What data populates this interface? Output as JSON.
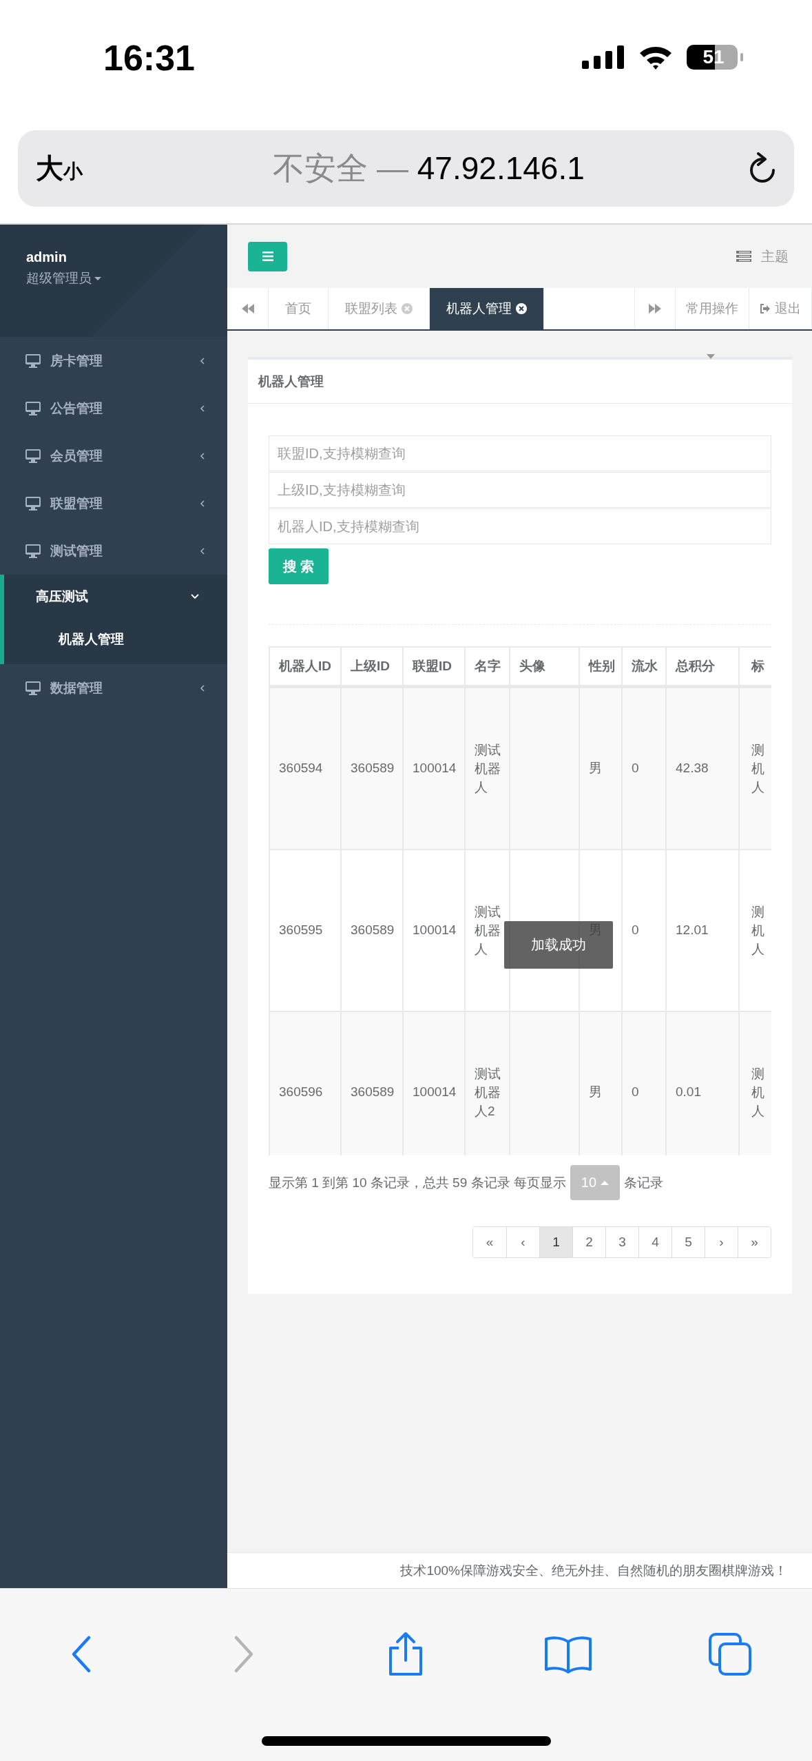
{
  "status_bar": {
    "time": "16:31",
    "battery": "51"
  },
  "browser": {
    "text_size_large": "大",
    "text_size_small": "小",
    "security": "不安全 —",
    "address": "47.92.146.1"
  },
  "sidebar": {
    "user": {
      "name": "admin",
      "role": "超级管理员"
    },
    "items": [
      {
        "label": "房卡管理",
        "expanded": false
      },
      {
        "label": "公告管理",
        "expanded": false
      },
      {
        "label": "会员管理",
        "expanded": false
      },
      {
        "label": "联盟管理",
        "expanded": false
      },
      {
        "label": "测试管理",
        "expanded": false,
        "children": [
          {
            "label": "高压测试",
            "expanded": true,
            "children": [
              {
                "label": "机器人管理",
                "selected": true
              }
            ]
          }
        ]
      },
      {
        "label": "数据管理",
        "expanded": false
      }
    ]
  },
  "header": {
    "theme": "主题"
  },
  "tabs": [
    {
      "label": "首页",
      "closable": false,
      "selected": false
    },
    {
      "label": "联盟列表",
      "closable": true,
      "selected": false
    },
    {
      "label": "机器人管理",
      "closable": true,
      "selected": true
    }
  ],
  "tab_actions": {
    "common": "常用操作",
    "logout": "退出"
  },
  "card": {
    "title": "机器人管理",
    "filters": [
      {
        "placeholder": "联盟ID,支持模糊查询"
      },
      {
        "placeholder": "上级ID,支持模糊查询"
      },
      {
        "placeholder": "机器人ID,支持模糊查询"
      }
    ],
    "search_button": "搜 索",
    "table": {
      "columns": [
        "机器人ID",
        "上级ID",
        "联盟ID",
        "名字",
        "头像",
        "性别",
        "流水",
        "总积分",
        "标"
      ],
      "rows": [
        [
          "360594",
          "360589",
          "100014",
          "测试机器人",
          null,
          "男",
          "0",
          "42.38",
          "测机人"
        ],
        [
          "360595",
          "360589",
          "100014",
          "测试机器人",
          null,
          "男",
          "0",
          "12.01",
          "测机人"
        ],
        [
          "360596",
          "360589",
          "100014",
          "测试机器人2",
          null,
          "男",
          "0",
          "0.01",
          "测机人"
        ]
      ]
    },
    "summary": "显示第 1 到第 10 条记录，总共 59 条记录 每页显示",
    "page_size": "10",
    "summary_suffix": "条记录",
    "pages": [
      {
        "label": "«",
        "selected": false
      },
      {
        "label": "‹",
        "selected": false
      },
      {
        "label": "1",
        "selected": true
      },
      {
        "label": "2",
        "selected": false
      },
      {
        "label": "3",
        "selected": false
      },
      {
        "label": "4",
        "selected": false
      },
      {
        "label": "5",
        "selected": false
      },
      {
        "label": "›",
        "selected": false
      },
      {
        "label": "»",
        "selected": false
      }
    ]
  },
  "toast": "加载成功",
  "footer": "技术100%保障游戏安全、绝无外挂、自然随机的朋友圈棋牌游戏！",
  "toolbar": [
    {
      "kind": "back",
      "disabled": false
    },
    {
      "kind": "forward",
      "disabled": true
    },
    {
      "kind": "share",
      "disabled": false
    },
    {
      "kind": "bookmarks",
      "disabled": false
    },
    {
      "kind": "tabs",
      "disabled": false
    }
  ]
}
